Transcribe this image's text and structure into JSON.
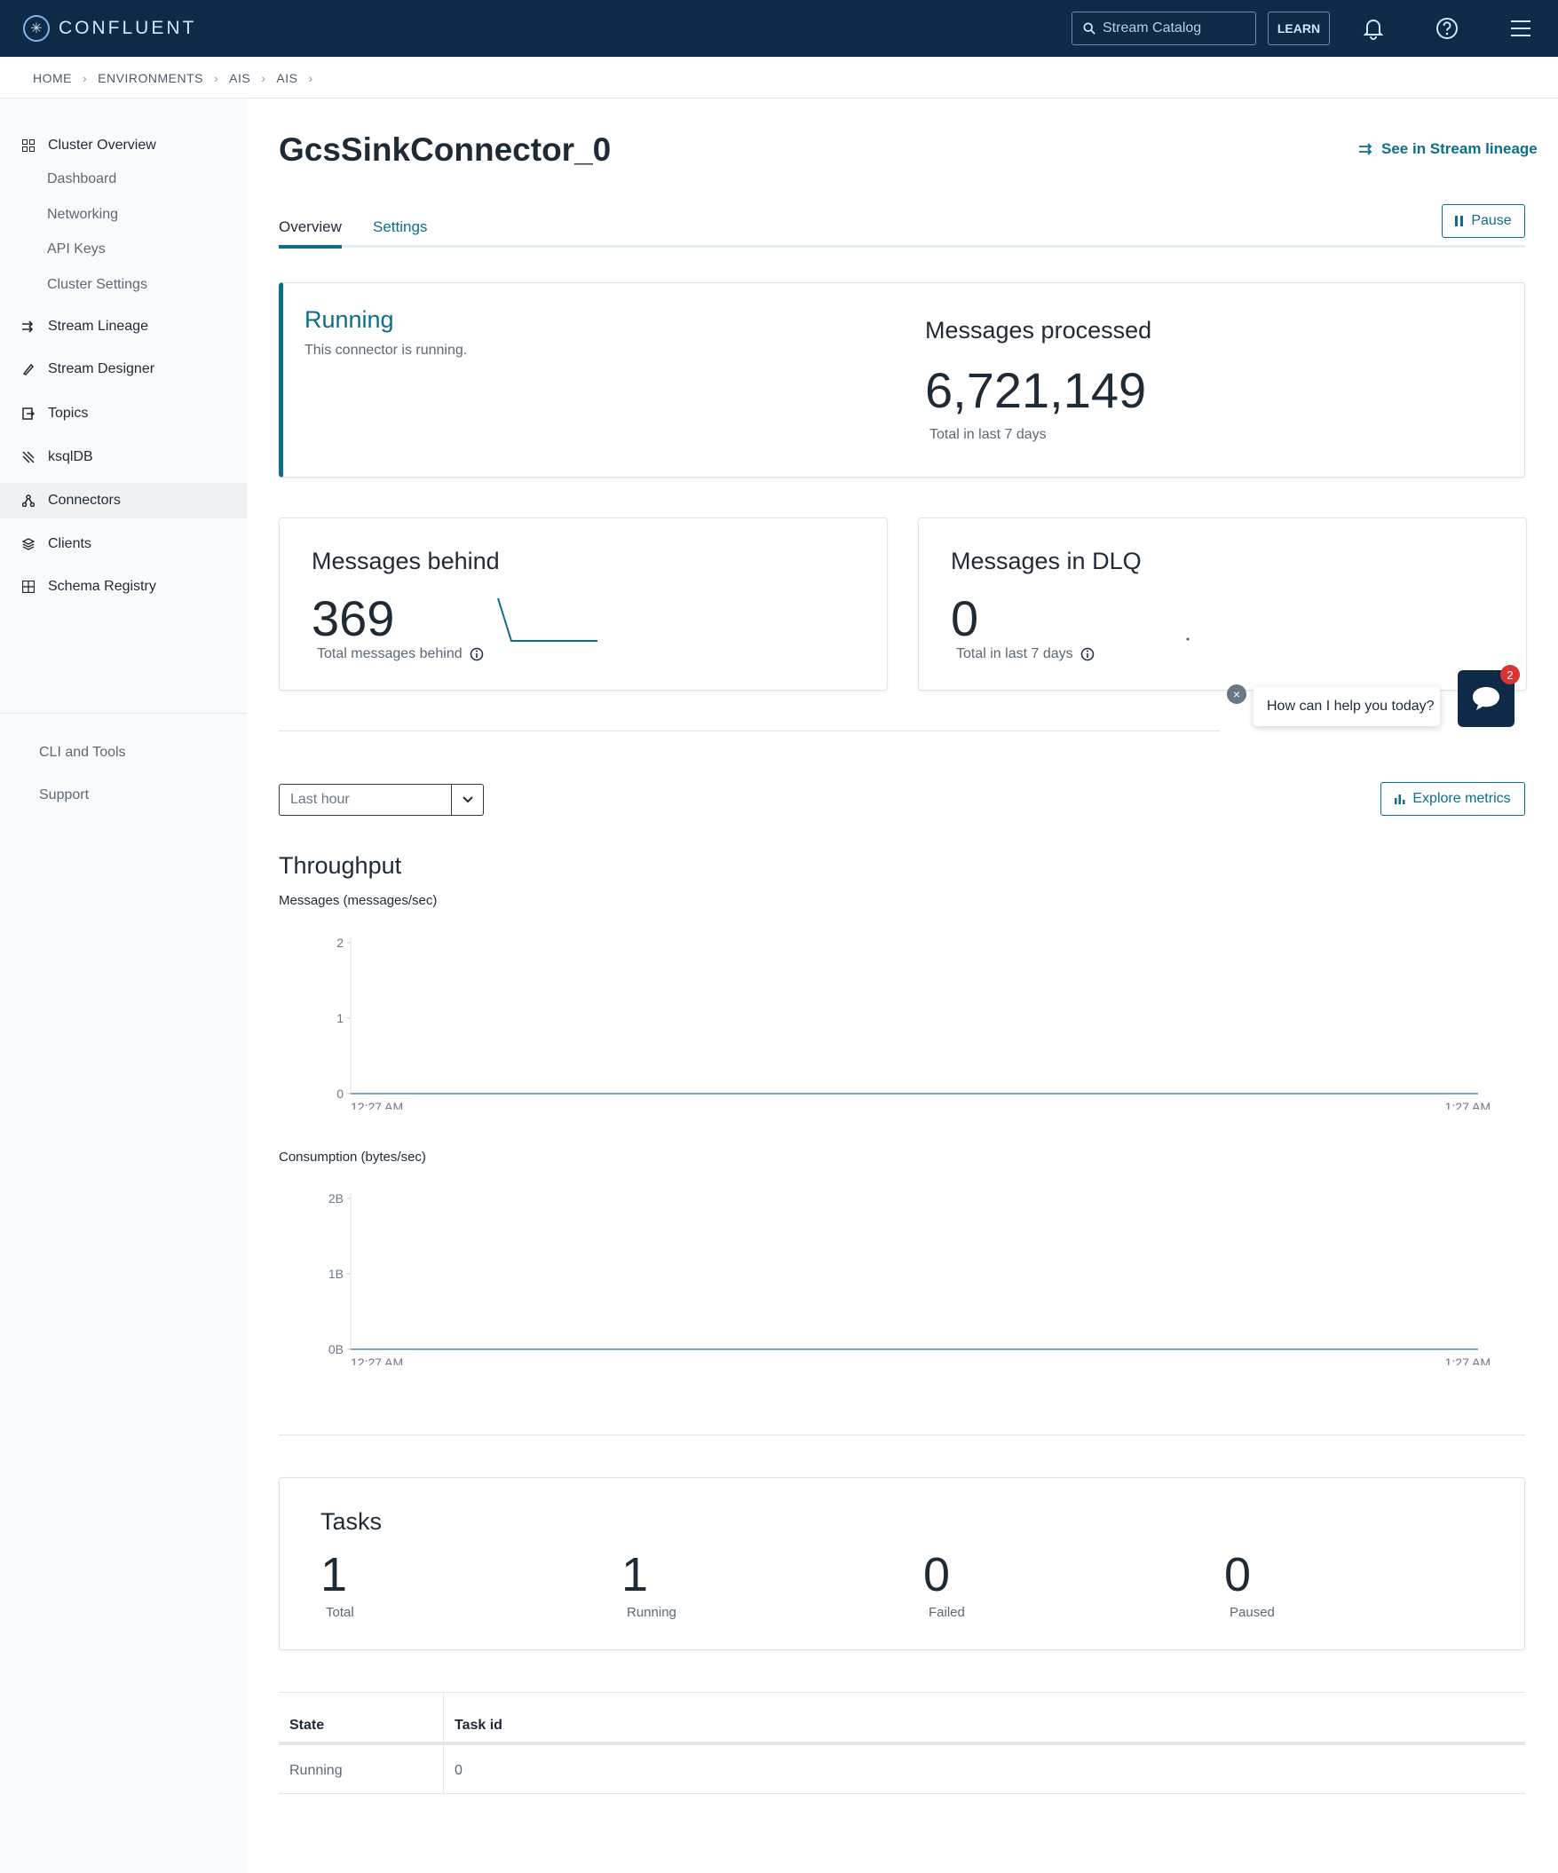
{
  "app": {
    "brand": "CONFLUENT",
    "search_placeholder": "Stream Catalog",
    "learn_label": "LEARN"
  },
  "breadcrumb": [
    "HOME",
    "ENVIRONMENTS",
    "AIS",
    "AIS"
  ],
  "sidebar": {
    "cluster_overview": "Cluster Overview",
    "sub_items": [
      "Dashboard",
      "Networking",
      "API Keys",
      "Cluster Settings"
    ],
    "items": [
      "Stream Lineage",
      "Stream Designer",
      "Topics",
      "ksqlDB",
      "Connectors",
      "Clients",
      "Schema Registry"
    ],
    "footer": [
      "CLI and Tools",
      "Support"
    ]
  },
  "page": {
    "title": "GcsSinkConnector_0",
    "lineage_link": "See in Stream lineage",
    "tabs": [
      "Overview",
      "Settings"
    ],
    "pause_label": "Pause"
  },
  "status": {
    "state": "Running",
    "description": "This connector is running.",
    "processed_title": "Messages processed",
    "processed_value": "6,721,149",
    "processed_sub": "Total in last 7 days"
  },
  "behind": {
    "title": "Messages behind",
    "value": "369",
    "sub": "Total messages behind"
  },
  "dlq": {
    "title": "Messages in DLQ",
    "value": "0",
    "sub": "Total in last 7 days"
  },
  "chat": {
    "prompt": "How can I help you today?",
    "badge": "2"
  },
  "filters": {
    "range": "Last hour",
    "explore_label": "Explore metrics"
  },
  "throughput": {
    "title": "Throughput"
  },
  "chart_data": [
    {
      "type": "line",
      "title": "Messages (messages/sec)",
      "x": [
        "12:27 AM",
        "1:27 AM"
      ],
      "series": [
        {
          "values": [
            0,
            0
          ]
        }
      ],
      "yticks": [
        "0",
        "1",
        "2"
      ],
      "ylim": [
        0,
        2
      ]
    },
    {
      "type": "line",
      "title": "Consumption (bytes/sec)",
      "x": [
        "12:27 AM",
        "1:27 AM"
      ],
      "series": [
        {
          "values": [
            0,
            0
          ]
        }
      ],
      "yticks": [
        "0B",
        "1B",
        "2B"
      ],
      "ylim": [
        0,
        2
      ]
    }
  ],
  "tasks": {
    "title": "Tasks",
    "stats": [
      {
        "value": "1",
        "label": "Total"
      },
      {
        "value": "1",
        "label": "Running"
      },
      {
        "value": "0",
        "label": "Failed"
      },
      {
        "value": "0",
        "label": "Paused"
      }
    ]
  },
  "task_table": {
    "headers": [
      "State",
      "Task id"
    ],
    "rows": [
      [
        "Running",
        "0"
      ]
    ]
  },
  "colors": {
    "accent": "#0c6e8a",
    "topbar": "#0e2a47",
    "badge": "#d93434"
  }
}
